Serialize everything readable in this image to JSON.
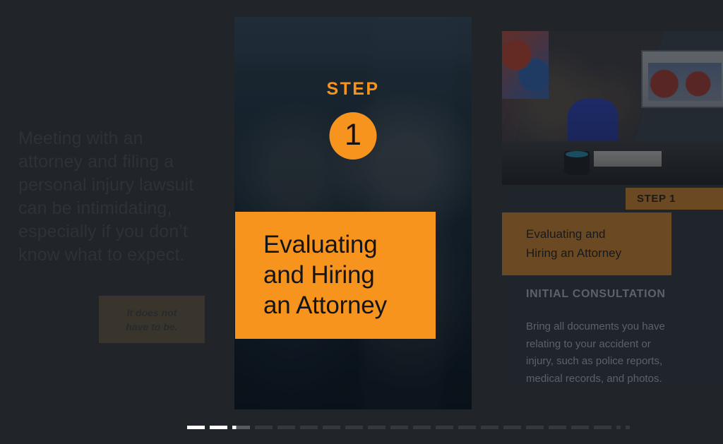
{
  "theme": {
    "background": "#212529",
    "accent_orange": "#F7941E",
    "dim_orange": "#6B4A23",
    "active_dash": "#FFFFFF",
    "inactive_dash": "#35393D"
  },
  "left_panel": {
    "intro_paragraph": "Meeting with an attorney and filing a personal injury lawsuit can be intimidating, especially if you don’t know what to expect.",
    "callout_line1": "It does not",
    "callout_line2": "have to be."
  },
  "center_card": {
    "step_word": "STEP",
    "step_number": "1",
    "title_line1": "Evaluating",
    "title_line2": "and Hiring",
    "title_line3": "an Attorney"
  },
  "right_panel": {
    "step_badge": "STEP 1",
    "title_line1": "Evaluating and",
    "title_line2": "Hiring an Attorney",
    "kicker": "INITIAL CONSULTATION",
    "body_line1": "Bring all documents you have",
    "body_line2": "relating to your accident or",
    "body_line3": "injury, such as police reports,",
    "body_line4": "medical records, and photos."
  },
  "pagination": {
    "total": 21,
    "current_index": 3,
    "items": [
      {
        "shape": "long",
        "state": "active"
      },
      {
        "shape": "long",
        "state": "active"
      },
      {
        "shape": "long",
        "state": "partial"
      },
      {
        "shape": "long",
        "state": "inactive"
      },
      {
        "shape": "long",
        "state": "inactive"
      },
      {
        "shape": "long",
        "state": "inactive"
      },
      {
        "shape": "long",
        "state": "inactive"
      },
      {
        "shape": "long",
        "state": "inactive"
      },
      {
        "shape": "long",
        "state": "inactive"
      },
      {
        "shape": "long",
        "state": "inactive"
      },
      {
        "shape": "long",
        "state": "inactive"
      },
      {
        "shape": "long",
        "state": "inactive"
      },
      {
        "shape": "long",
        "state": "inactive"
      },
      {
        "shape": "long",
        "state": "inactive"
      },
      {
        "shape": "long",
        "state": "inactive"
      },
      {
        "shape": "long",
        "state": "inactive"
      },
      {
        "shape": "long",
        "state": "inactive"
      },
      {
        "shape": "long",
        "state": "inactive"
      },
      {
        "shape": "long",
        "state": "inactive"
      },
      {
        "shape": "dot",
        "state": "inactive"
      },
      {
        "shape": "dot",
        "state": "inactive"
      }
    ]
  }
}
